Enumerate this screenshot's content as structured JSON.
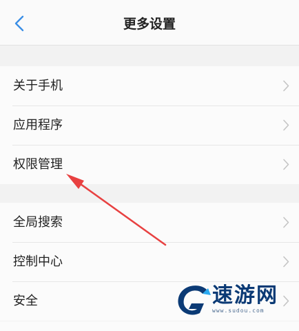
{
  "header": {
    "title": "更多设置",
    "back_icon": "chevron-left-icon"
  },
  "groups": [
    {
      "items": [
        {
          "label": "关于手机"
        },
        {
          "label": "应用程序"
        },
        {
          "label": "权限管理"
        }
      ]
    },
    {
      "items": [
        {
          "label": "全局搜索"
        },
        {
          "label": "控制中心"
        },
        {
          "label": "安全"
        }
      ]
    }
  ],
  "watermark": {
    "name": "速游网",
    "url": "www.sudou.com"
  },
  "colors": {
    "accent": "#3a8ee6",
    "annotation_arrow": "#e84141",
    "watermark_blue": "#0b3a75",
    "watermark_light": "#29a9f0"
  }
}
